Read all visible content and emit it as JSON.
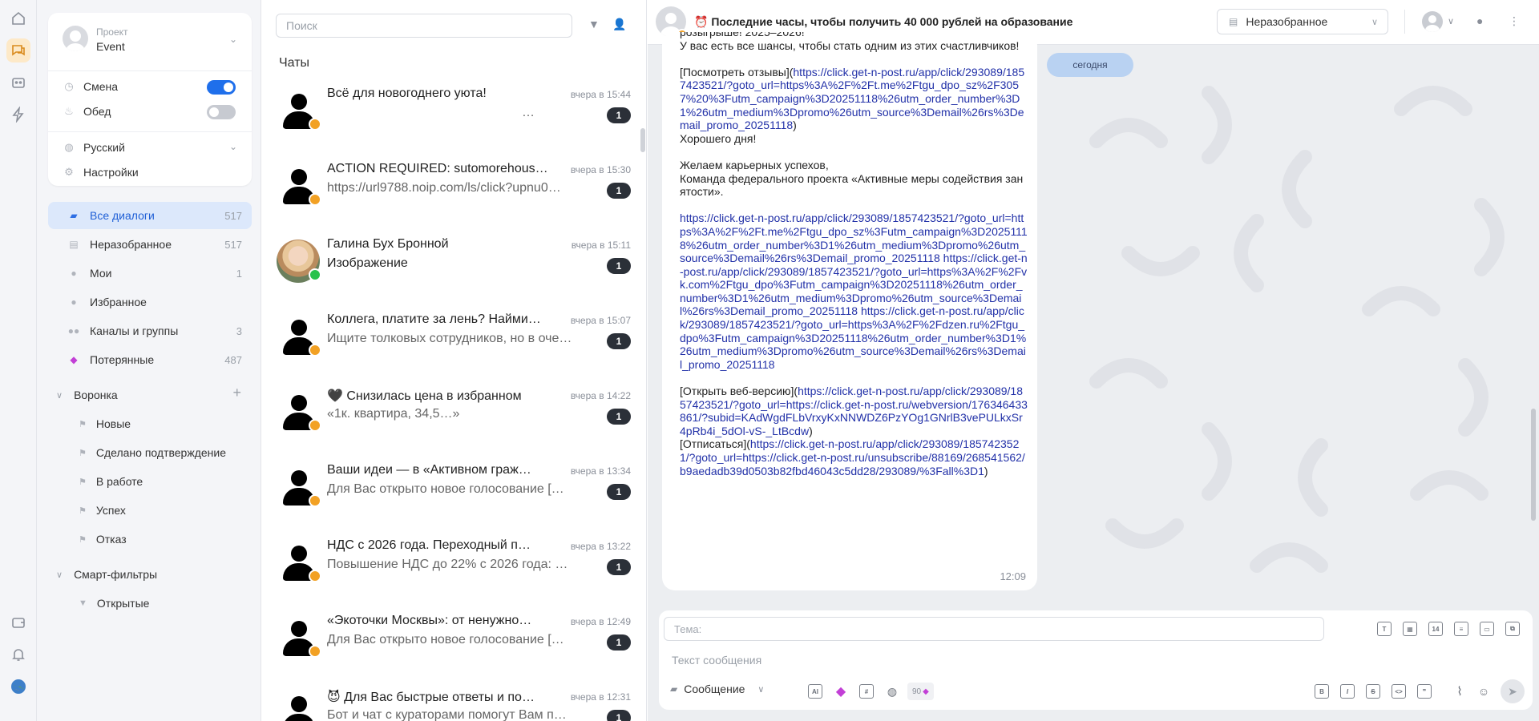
{
  "colors": {
    "accent": "#1f6feb",
    "active_bg": "#dce8fb",
    "rail_active": "#fde9c8",
    "unread_bg": "#2b3038",
    "link": "#2231a8",
    "date_pill": "#b9d2f2"
  },
  "rail": {
    "icons": [
      "home-icon",
      "chats-icon",
      "bot-icon",
      "lightning-icon",
      "wallet-icon",
      "bell-icon",
      "globe-avatar-icon"
    ]
  },
  "project": {
    "label": "Проект",
    "name": "Event"
  },
  "toggles": [
    {
      "label": "Смена",
      "on": true
    },
    {
      "label": "Обед",
      "on": false
    }
  ],
  "settings": {
    "language": "Русский",
    "settings_label": "Настройки"
  },
  "nav": [
    {
      "label": "Все диалоги",
      "count": "517",
      "icon": "chat-icon"
    },
    {
      "label": "Неразобранное",
      "count": "517",
      "icon": "inbox-icon"
    },
    {
      "label": "Мои",
      "count": "1",
      "icon": "user-icon"
    },
    {
      "label": "Избранное",
      "count": "",
      "icon": "star-icon"
    },
    {
      "label": "Каналы и группы",
      "count": "3",
      "icon": "group-icon"
    },
    {
      "label": "Потерянные",
      "count": "487",
      "icon": "diamond-icon"
    }
  ],
  "funnel": {
    "title": "Воронка",
    "items": [
      "Новые",
      "Сделано подтверждение",
      "В работе",
      "Успех",
      "Отказ"
    ]
  },
  "smart_filters": {
    "title": "Смарт-фильтры",
    "items": [
      "Открытые"
    ]
  },
  "list": {
    "search_placeholder": "Поиск",
    "title": "Чаты",
    "chats": [
      {
        "title": "Всё для новогоднего уюта!",
        "subtitle": "…",
        "time": "вчера в 15:44",
        "unread": "1",
        "avatar": "silhouette",
        "channel": "email"
      },
      {
        "title": "ACTION REQUIRED: sutomorehouse…",
        "subtitle": "https://url9788.noip.com/ls/click?upnu0…",
        "time": "вчера в 15:30",
        "unread": "1",
        "avatar": "silhouette",
        "channel": "email"
      },
      {
        "title": "Галина Бух Бронной",
        "subtitle": "Изображение",
        "time": "вчера в 15:11",
        "unread": "1",
        "avatar": "photo",
        "channel": "whatsapp"
      },
      {
        "title": "Коллега, платите за лень? Найми…",
        "subtitle": "Ищите толковых сотрудников, но в оче…",
        "time": "вчера в 15:07",
        "unread": "1",
        "avatar": "silhouette",
        "channel": "email"
      },
      {
        "title": "🖤 Снизилась цена в избранном",
        "subtitle": "«1к. квартира, 34,5…»",
        "time": "вчера в 14:22",
        "unread": "1",
        "avatar": "silhouette",
        "channel": "email"
      },
      {
        "title": "Ваши идеи — в «Активном граж…",
        "subtitle": "Для Вас открыто новое голосование […",
        "time": "вчера в 13:34",
        "unread": "1",
        "avatar": "silhouette",
        "channel": "email"
      },
      {
        "title": "НДС с 2026 года. Переходный п…",
        "subtitle": "Повышение НДС до 22% с 2026 года: …",
        "time": "вчера в 13:22",
        "unread": "1",
        "avatar": "silhouette",
        "channel": "email"
      },
      {
        "title": "«Экоточки Москвы»: от ненужно…",
        "subtitle": "Для Вас открыто новое голосование […",
        "time": "вчера в 12:49",
        "unread": "1",
        "avatar": "silhouette",
        "channel": "email"
      },
      {
        "title": "😈 Для Вас быстрые ответы и по…",
        "subtitle": "Бот и чат с кураторами помогут Вам п…",
        "time": "вчера в 12:31",
        "unread": "1",
        "avatar": "silhouette",
        "channel": "email"
      }
    ]
  },
  "header": {
    "title": "⏰ Последние часы, чтобы получить 40 000 рублей на образование",
    "status_select": "Неразобранное"
  },
  "date_pill": "сегодня",
  "message": {
    "time": "12:09",
    "parts": [
      {
        "t": "text",
        "v": "розыгрыше! 2025–2026!\nУ вас есть все шансы, чтобы стать одним из этих счастливчиков!\n\n[Посмотреть отзывы]("
      },
      {
        "t": "link",
        "v": "https://click.get-n-post.ru/app/click/293089/1857423521/?goto_url=https%3A%2F%2Ft.me%2Ftgu_dpo_sz%2F3057%20%3Futm_campaign%3D20251118%26utm_order_number%3D1%26utm_medium%3Dpromo%26utm_source%3Demail%26rs%3Demail_promo_20251118"
      },
      {
        "t": "text",
        "v": ")\nХорошего дня!\n\nЖелаем карьерных успехов,\nКоманда федерального проекта «Активные меры содействия занятости».\n\n"
      },
      {
        "t": "link",
        "v": "https://click.get-n-post.ru/app/click/293089/1857423521/?goto_url=https%3A%2F%2Ft.me%2Ftgu_dpo_sz%3Futm_campaign%3D20251118%26utm_order_number%3D1%26utm_medium%3Dpromo%26utm_source%3Demail%26rs%3Demail_promo_20251118"
      },
      {
        "t": "text",
        "v": " "
      },
      {
        "t": "link",
        "v": "https://click.get-n-post.ru/app/click/293089/1857423521/?goto_url=https%3A%2F%2Fvk.com%2Ftgu_dpo%3Futm_campaign%3D20251118%26utm_order_number%3D1%26utm_medium%3Dpromo%26utm_source%3Demail%26rs%3Demail_promo_20251118"
      },
      {
        "t": "text",
        "v": " "
      },
      {
        "t": "link",
        "v": "https://click.get-n-post.ru/app/click/293089/1857423521/?goto_url=https%3A%2F%2Fdzen.ru%2Ftgu_dpo%3Futm_campaign%3D20251118%26utm_order_number%3D1%26utm_medium%3Dpromo%26utm_source%3Demail%26rs%3Demail_promo_20251118"
      },
      {
        "t": "text",
        "v": "\n\n[Открыть веб-версию]("
      },
      {
        "t": "link",
        "v": "https://click.get-n-post.ru/app/click/293089/1857423521/?goto_url=https://click.get-n-post.ru/webversion/176346433861/?subid=KAdWgdFLbVrxyKxNNWDZ6PzYOg1GNrlB3vePULkxSr4pRb4i_5dOl-vS-_LtBcdw"
      },
      {
        "t": "text",
        "v": ")\n[Отписаться]("
      },
      {
        "t": "link",
        "v": "https://click.get-n-post.ru/app/click/293089/1857423521/?goto_url=https://click.get-n-post.ru/unsubscribe/88169/268541562/b9aedadb39d0503b82fbd46043c5dd28/293089/%3Fall%3D1"
      },
      {
        "t": "text",
        "v": ")"
      }
    ]
  },
  "composer": {
    "topic_placeholder": "Тема:",
    "message_placeholder": "Текст сообщения",
    "type": "Сообщение",
    "counter": "90",
    "top_tools": [
      "template-icon",
      "calendar-icon",
      "date-14-icon",
      "note-icon",
      "clipboard-icon",
      "copy-icon"
    ],
    "format_tools": [
      {
        "name": "bold-icon",
        "glyph": "B"
      },
      {
        "name": "italic-icon",
        "glyph": "I"
      },
      {
        "name": "strike-icon",
        "glyph": "S"
      },
      {
        "name": "code-icon",
        "glyph": "<>"
      },
      {
        "name": "quote-icon",
        "glyph": "❞"
      }
    ]
  }
}
